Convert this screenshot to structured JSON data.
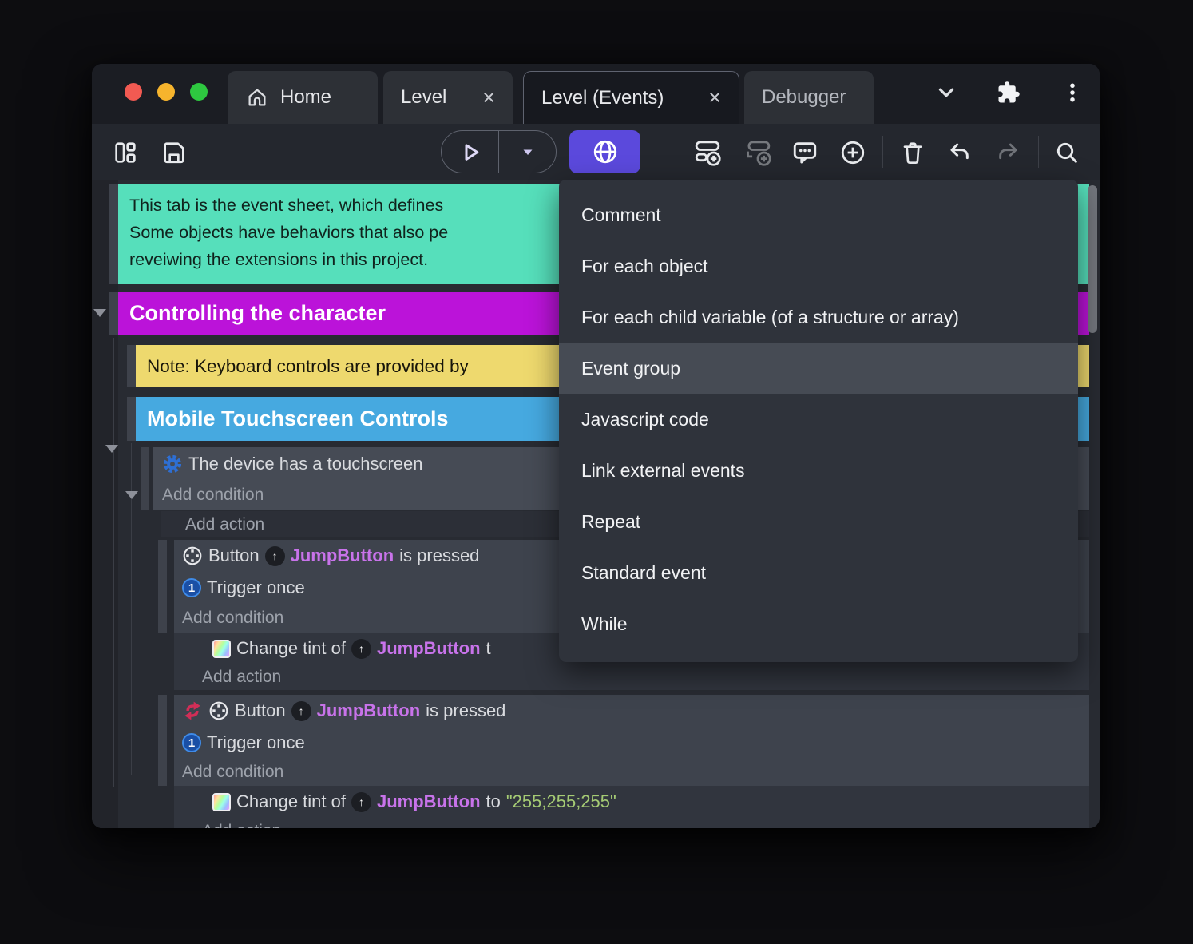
{
  "colors": {
    "accent_indigo": "#5b49dc",
    "comment_green": "#56dfbb",
    "group_purple": "#bb13d9",
    "note_yellow": "#eed96e",
    "group_blue": "#46a9e0",
    "object_link_purple": "#c873ea",
    "string_literal_green": "#a5cb74",
    "invert_red": "#d12e57",
    "system_gear_blue": "#2e6fd4",
    "menu_highlight": "#464b54"
  },
  "icons": {
    "tab_close": "×",
    "up_arrow": "↑",
    "trigger_once_digit": "1"
  },
  "titlebar": {
    "tabs": [
      {
        "label": "Home"
      },
      {
        "label": "Level"
      },
      {
        "label": "Level (Events)"
      },
      {
        "label": "Debugger"
      }
    ]
  },
  "context_menu": {
    "items": [
      "Comment",
      "For each object",
      "For each child variable (of a structure or array)",
      "Event group",
      "Javascript code",
      "Link external events",
      "Repeat",
      "Standard event",
      "While"
    ],
    "highlighted_item": "Event group"
  },
  "sheet": {
    "comment_lines": [
      "This tab is the event sheet, which defines",
      "Some objects have behaviors that also pe",
      "reveiwing the extensions in this project."
    ],
    "group1_title": "Controlling the character",
    "note_text": "Note: Keyboard controls are provided by",
    "group2_title": "Mobile Touchscreen Controls",
    "add_condition": "Add condition",
    "add_action": "Add action",
    "cond_touchscreen": "The device has a touchscreen",
    "cond_button_prefix": "Button",
    "object_name": "JumpButton",
    "cond_button_suffix": "is pressed",
    "trigger_once": "Trigger once",
    "action_tint_prefix": "Change tint of",
    "action_tint_partial_tail": "t",
    "action_tint_to": "to",
    "action_tint_value": "\"255;255;255\""
  }
}
